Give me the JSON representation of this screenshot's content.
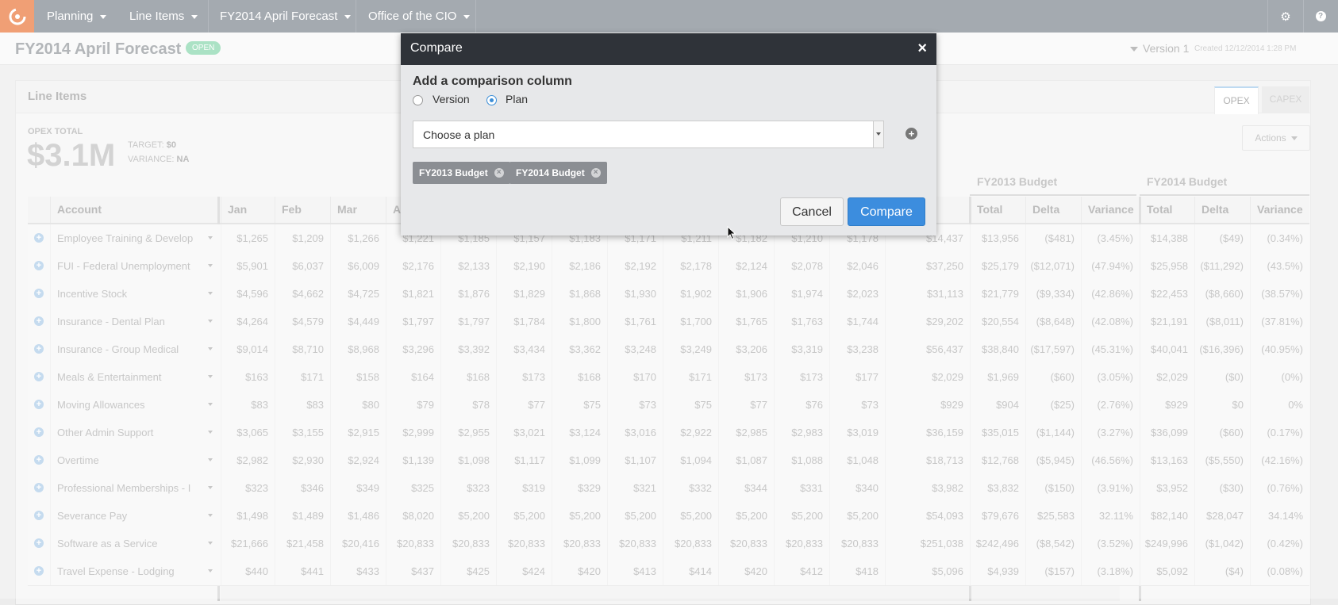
{
  "nav": {
    "items": [
      {
        "label": "Planning"
      },
      {
        "label": "Line Items"
      },
      {
        "label": "FY2014 April Forecast"
      },
      {
        "label": "Office of the CIO"
      }
    ],
    "settings_icon": "gear-icon",
    "help_icon": "help-icon"
  },
  "page": {
    "title": "FY2014 April Forecast",
    "status_badge": "OPEN",
    "version": "Version 1",
    "created": "Created 12/12/2014 1:28 PM"
  },
  "panel": {
    "title": "Line Items",
    "tabs": [
      "OPEX",
      "CAPEX"
    ],
    "opex_label": "OPEX TOTAL",
    "opex_value": "$3.1M",
    "target_label": "TARGET:",
    "target_value": "$0",
    "variance_label": "VARIANCE:",
    "variance_value": "NA",
    "actions_label": "Actions"
  },
  "groups": [
    "FY2013 Budget",
    "FY2014 Budget"
  ],
  "table": {
    "headers": [
      "Account",
      "Jan",
      "Feb",
      "Mar",
      "A",
      "",
      "",
      "",
      "",
      "",
      "",
      "",
      "",
      "",
      "Total",
      "Delta",
      "Variance",
      "Total",
      "Delta",
      "Variance"
    ],
    "rows": [
      {
        "account": "Employee Training & Develop",
        "values": [
          "$1,265",
          "$1,209",
          "$1,266",
          "$1,221",
          "$1,185",
          "$1,157",
          "$1,183",
          "$1,171",
          "$1,211",
          "$1,182",
          "$1,210",
          "$1,178",
          "$14,437",
          "$13,956",
          "($481)",
          "(3.45%)",
          "$14,388",
          "($49)",
          "(0.34%)"
        ]
      },
      {
        "account": "FUI - Federal Unemployment",
        "values": [
          "$5,901",
          "$6,037",
          "$6,009",
          "$2,176",
          "$2,133",
          "$2,190",
          "$2,186",
          "$2,192",
          "$2,178",
          "$2,124",
          "$2,078",
          "$2,046",
          "$37,250",
          "$25,179",
          "($12,071)",
          "(47.94%)",
          "$25,958",
          "($11,292)",
          "(43.5%)"
        ]
      },
      {
        "account": "Incentive Stock",
        "values": [
          "$4,596",
          "$4,662",
          "$4,725",
          "$1,821",
          "$1,876",
          "$1,829",
          "$1,868",
          "$1,930",
          "$1,902",
          "$1,906",
          "$1,974",
          "$2,023",
          "$31,113",
          "$21,779",
          "($9,334)",
          "(42.86%)",
          "$22,453",
          "($8,660)",
          "(38.57%)"
        ]
      },
      {
        "account": "Insurance - Dental Plan",
        "values": [
          "$4,264",
          "$4,579",
          "$4,449",
          "$1,797",
          "$1,797",
          "$1,784",
          "$1,800",
          "$1,761",
          "$1,700",
          "$1,765",
          "$1,763",
          "$1,744",
          "$29,202",
          "$20,554",
          "($8,648)",
          "(42.08%)",
          "$21,191",
          "($8,011)",
          "(37.81%)"
        ]
      },
      {
        "account": "Insurance - Group Medical",
        "values": [
          "$9,014",
          "$8,710",
          "$8,968",
          "$3,296",
          "$3,392",
          "$3,434",
          "$3,362",
          "$3,248",
          "$3,249",
          "$3,206",
          "$3,319",
          "$3,238",
          "$56,437",
          "$38,840",
          "($17,597)",
          "(45.31%)",
          "$40,041",
          "($16,396)",
          "(40.95%)"
        ]
      },
      {
        "account": "Meals & Entertainment",
        "values": [
          "$163",
          "$171",
          "$158",
          "$164",
          "$168",
          "$173",
          "$168",
          "$170",
          "$171",
          "$173",
          "$173",
          "$177",
          "$2,029",
          "$1,969",
          "($60)",
          "(3.05%)",
          "$2,029",
          "($0)",
          "(0%)"
        ]
      },
      {
        "account": "Moving Allowances",
        "values": [
          "$83",
          "$83",
          "$80",
          "$79",
          "$78",
          "$77",
          "$75",
          "$73",
          "$75",
          "$77",
          "$76",
          "$73",
          "$929",
          "$904",
          "($25)",
          "(2.76%)",
          "$929",
          "$0",
          "0%"
        ]
      },
      {
        "account": "Other Admin Support",
        "values": [
          "$3,065",
          "$3,155",
          "$2,915",
          "$2,999",
          "$2,955",
          "$3,021",
          "$3,124",
          "$3,016",
          "$2,922",
          "$2,985",
          "$2,983",
          "$3,019",
          "$36,159",
          "$35,015",
          "($1,144)",
          "(3.27%)",
          "$36,099",
          "($60)",
          "(0.17%)"
        ]
      },
      {
        "account": "Overtime",
        "values": [
          "$2,982",
          "$2,930",
          "$2,924",
          "$1,139",
          "$1,098",
          "$1,117",
          "$1,099",
          "$1,107",
          "$1,094",
          "$1,087",
          "$1,088",
          "$1,048",
          "$18,713",
          "$12,768",
          "($5,945)",
          "(46.56%)",
          "$13,163",
          "($5,550)",
          "(42.16%)"
        ]
      },
      {
        "account": "Professional Memberships - I",
        "values": [
          "$323",
          "$346",
          "$349",
          "$325",
          "$323",
          "$319",
          "$329",
          "$321",
          "$332",
          "$344",
          "$331",
          "$340",
          "$3,982",
          "$3,832",
          "($150)",
          "(3.91%)",
          "$3,952",
          "($30)",
          "(0.76%)"
        ]
      },
      {
        "account": "Severance Pay",
        "values": [
          "$1,498",
          "$1,489",
          "$1,486",
          "$8,020",
          "$5,200",
          "$5,200",
          "$5,200",
          "$5,200",
          "$5,200",
          "$5,200",
          "$5,200",
          "$5,200",
          "$54,093",
          "$79,676",
          "$25,583",
          "32.11%",
          "$82,140",
          "$28,047",
          "34.14%"
        ]
      },
      {
        "account": "Software as a Service",
        "values": [
          "$21,666",
          "$21,458",
          "$20,416",
          "$20,833",
          "$20,833",
          "$20,833",
          "$20,833",
          "$20,833",
          "$20,833",
          "$20,833",
          "$20,833",
          "$20,833",
          "$251,038",
          "$242,496",
          "($8,542)",
          "(3.52%)",
          "$249,996",
          "($1,042)",
          "(0.42%)"
        ]
      },
      {
        "account": "Travel Expense - Lodging",
        "values": [
          "$440",
          "$441",
          "$433",
          "$437",
          "$425",
          "$424",
          "$420",
          "$413",
          "$414",
          "$420",
          "$412",
          "$418",
          "$5,096",
          "$4,939",
          "($157)",
          "(3.18%)",
          "$5,092",
          "($4)",
          "(0.08%)"
        ]
      }
    ]
  },
  "modal": {
    "title": "Compare",
    "close_icon": "close-icon",
    "heading": "Add a comparison column",
    "radio_version": "Version",
    "radio_plan": "Plan",
    "select_placeholder": "Choose a plan",
    "chips": [
      "FY2013 Budget",
      "FY2014 Budget"
    ],
    "cancel_label": "Cancel",
    "compare_label": "Compare"
  },
  "colors": {
    "nav_bg": "#747d86",
    "logo_bg": "#e86c2c",
    "primary_button": "#3c8dde",
    "modal_header": "#2f3339"
  }
}
